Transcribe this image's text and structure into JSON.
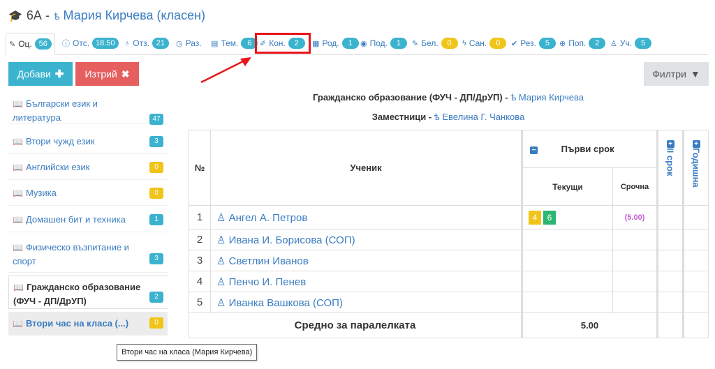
{
  "header": {
    "class_name": "6А -",
    "teacher_icon": "teacher-glyph",
    "teacher": "Мария Кирчева (класен)"
  },
  "tabs": [
    {
      "label": "Оц.",
      "icon": "pencil-icon",
      "count": "56"
    },
    {
      "label": "Отс.",
      "icon": "info-icon",
      "count": "18.50"
    },
    {
      "label": "Отз.",
      "icon": "award-icon",
      "count": "21"
    },
    {
      "label": "Раз.",
      "icon": "clock-icon",
      "count": ""
    },
    {
      "label": "Тем.",
      "icon": "list-icon",
      "count": "6"
    },
    {
      "label": "Кон.",
      "icon": "edit-icon",
      "count": "2"
    },
    {
      "label": "Род.",
      "icon": "calendar-icon",
      "count": "1"
    },
    {
      "label": "Под.",
      "icon": "eye-icon",
      "count": "1"
    },
    {
      "label": "Бел.",
      "icon": "note-icon",
      "count": "0"
    },
    {
      "label": "Сан.",
      "icon": "bolt-icon",
      "count": "0"
    },
    {
      "label": "Рез.",
      "icon": "check-circle-icon",
      "count": "5"
    },
    {
      "label": "Поп.",
      "icon": "lifebuoy-icon",
      "count": "2"
    },
    {
      "label": "Уч.",
      "icon": "student-icon",
      "count": "5"
    }
  ],
  "toolbar": {
    "add_label": "Добави",
    "delete_label": "Изтрий",
    "filter_label": "Филтри"
  },
  "subjects": [
    {
      "name": "Български език и литература",
      "count": "47"
    },
    {
      "name": "Втори чужд език",
      "count": "3"
    },
    {
      "name": "Английски език",
      "count": "0"
    },
    {
      "name": "Музика",
      "count": "0"
    },
    {
      "name": "Домашен бит и техника",
      "count": "1"
    },
    {
      "name": "Физическо възпитание и спорт",
      "count": "3"
    },
    {
      "name": "Гражданско образование (ФУЧ - ДП/ДрУП)",
      "count": "2"
    },
    {
      "name": "Втори час на класа (...)",
      "count": "0"
    }
  ],
  "tooltip": "Втори час на класа (Мария Кирчева)",
  "course": {
    "title": "Гражданско образование (ФУЧ - ДП/ДрУП)",
    "teacher": "Мария Кирчева",
    "deputies_label": "Заместници",
    "deputy": "Евелина Г. Чанкова"
  },
  "table": {
    "col_num": "№",
    "col_student": "Ученик",
    "term1": "Първи срок",
    "current": "Текущи",
    "term_grade": "Срочна",
    "term2": "II срок",
    "annual": "Годишна",
    "students": [
      {
        "num": "1",
        "name": "Ангел А. Петров",
        "grades": [
          "4",
          "6"
        ],
        "term": "(5.00)"
      },
      {
        "num": "2",
        "name": "Ивана И. Борисова (СОП)",
        "grades": [],
        "term": ""
      },
      {
        "num": "3",
        "name": "Светлин Иванов",
        "grades": [],
        "term": ""
      },
      {
        "num": "4",
        "name": "Пенчо И. Пенев",
        "grades": [],
        "term": ""
      },
      {
        "num": "5",
        "name": "Иванка Вашкова (СОП)",
        "grades": [],
        "term": ""
      }
    ],
    "avg_label": "Средно за паралелката",
    "avg_value": "5.00"
  },
  "colors": {
    "accent": "#3bb3cf",
    "link": "#3a7cc0",
    "danger": "#e55f5f",
    "warning": "#f0c419",
    "success": "#2bb673",
    "highlight": "#e8151b"
  }
}
